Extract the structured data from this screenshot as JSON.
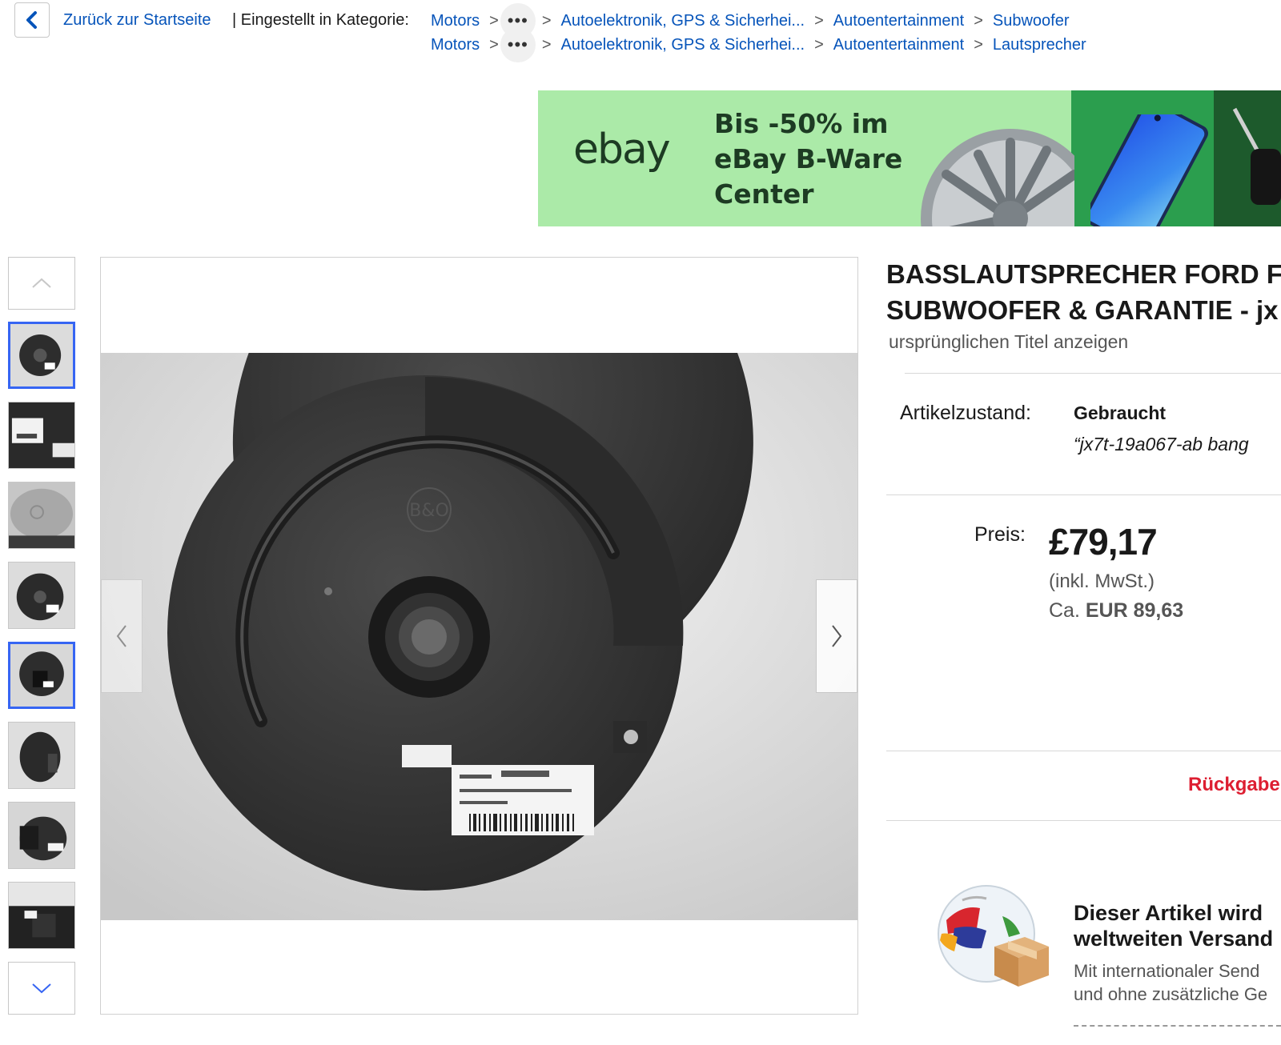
{
  "breadcrumb": {
    "back_label": "Zurück zur Startseite",
    "category_label": "| Eingestellt in Kategorie:",
    "more_label": "•••",
    "rows": [
      {
        "items": [
          "Motors",
          "Autoelektronik, GPS & Sicherhei...",
          "Autoentertainment",
          "Subwoofer"
        ]
      },
      {
        "items": [
          "Motors",
          "Autoelektronik, GPS & Sicherhei...",
          "Autoentertainment",
          "Lautsprecher"
        ]
      }
    ]
  },
  "banner": {
    "logo": "ebay",
    "promo_text": "Bis -50% im eBay B-Ware Center"
  },
  "gallery": {
    "thumbnail_count": 8,
    "selected_thumbnails": [
      1,
      5
    ]
  },
  "listing": {
    "title_line1": "BASSLAUTSPRECHER FORD F",
    "title_line2": "SUBWOOFER & GARANTIE - jx",
    "original_title_link": "ursprünglichen Titel anzeigen",
    "condition_label": "Artikelzustand:",
    "condition_value": "Gebraucht",
    "condition_note": "“jx7t-19a067-ab bang",
    "price_label": "Preis:",
    "price_value": "£79,17",
    "price_vat": "(inkl. MwSt.)",
    "price_converted_prefix": "Ca.",
    "price_converted": "EUR 89,63",
    "returns_label": "Rückgabe",
    "shipping_title_line1": "Dieser Artikel wird",
    "shipping_title_line2": "weltweiten Versand",
    "shipping_sub_line1": "Mit internationaler Send",
    "shipping_sub_line2": "und ohne zusätzliche Ge"
  },
  "colors": {
    "link": "#0654ba",
    "selected_border": "#3665f3",
    "returns": "#dd1e31",
    "banner_green": "#abeaa8"
  }
}
